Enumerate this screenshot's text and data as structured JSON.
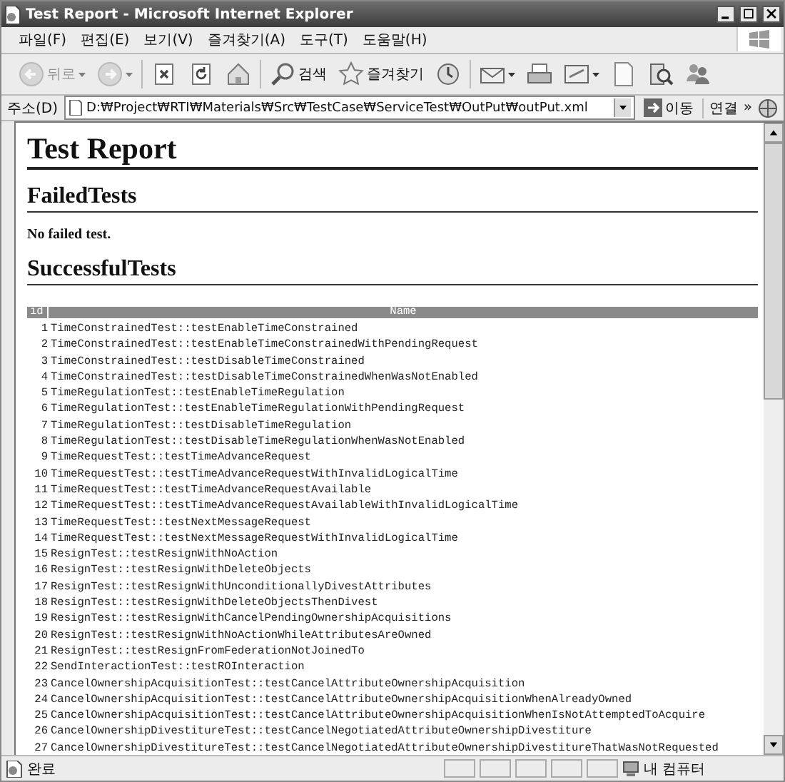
{
  "window": {
    "title": "Test Report - Microsoft Internet Explorer"
  },
  "menu": [
    {
      "label": "파일(F)"
    },
    {
      "label": "편집(E)"
    },
    {
      "label": "보기(V)"
    },
    {
      "label": "즐겨찾기(A)"
    },
    {
      "label": "도구(T)"
    },
    {
      "label": "도움말(H)"
    }
  ],
  "toolbar": [
    {
      "kind": "back",
      "label": "뒤로",
      "disabled": true,
      "dropdown": true
    },
    {
      "kind": "forward",
      "disabled": true,
      "dropdown": true
    },
    {
      "kind": "stop",
      "disabled": false
    },
    {
      "kind": "refresh",
      "disabled": false
    },
    {
      "kind": "home",
      "disabled": false
    },
    {
      "kind": "search",
      "label": "검색",
      "disabled": false
    },
    {
      "kind": "favorites",
      "label": "즐겨찾기",
      "disabled": false
    },
    {
      "kind": "history",
      "disabled": false
    },
    {
      "kind": "mail",
      "disabled": false,
      "dropdown": true
    },
    {
      "kind": "print",
      "disabled": false
    },
    {
      "kind": "edit",
      "disabled": false,
      "dropdown": true
    },
    {
      "kind": "page",
      "disabled": false
    },
    {
      "kind": "research",
      "disabled": false
    },
    {
      "kind": "messenger",
      "disabled": false
    }
  ],
  "address": {
    "label": "주소(D)",
    "value": "D:₩Project₩RTI₩Materials₩Src₩TestCase₩ServiceTest₩OutPut₩outPut.xml",
    "go": "이동",
    "links": "연결",
    "more": "»"
  },
  "document": {
    "title": "Test Report",
    "failed": {
      "heading": "FailedTests",
      "message": "No failed test."
    },
    "successful": {
      "heading": "SuccessfulTests",
      "columns": [
        "id",
        "Name"
      ],
      "rows": [
        {
          "id": "1",
          "name": "TimeConstrainedTest::testEnableTimeConstrained"
        },
        {
          "id": "2",
          "name": "TimeConstrainedTest::testEnableTimeConstrainedWithPendingRequest"
        },
        {
          "id": "3",
          "name": "TimeConstrainedTest::testDisableTimeConstrained"
        },
        {
          "id": "4",
          "name": "TimeConstrainedTest::testDisableTimeConstrainedWhenWasNotEnabled"
        },
        {
          "id": "5",
          "name": "TimeRegulationTest::testEnableTimeRegulation"
        },
        {
          "id": "6",
          "name": "TimeRegulationTest::testEnableTimeRegulationWithPendingRequest"
        },
        {
          "id": "7",
          "name": "TimeRegulationTest::testDisableTimeRegulation"
        },
        {
          "id": "8",
          "name": "TimeRegulationTest::testDisableTimeRegulationWhenWasNotEnabled"
        },
        {
          "id": "9",
          "name": "TimeRequestTest::testTimeAdvanceRequest"
        },
        {
          "id": "10",
          "name": "TimeRequestTest::testTimeAdvanceRequestWithInvalidLogicalTime"
        },
        {
          "id": "11",
          "name": "TimeRequestTest::testTimeAdvanceRequestAvailable"
        },
        {
          "id": "12",
          "name": "TimeRequestTest::testTimeAdvanceRequestAvailableWithInvalidLogicalTime"
        },
        {
          "id": "13",
          "name": "TimeRequestTest::testNextMessageRequest"
        },
        {
          "id": "14",
          "name": "TimeRequestTest::testNextMessageRequestWithInvalidLogicalTime"
        },
        {
          "id": "15",
          "name": "ResignTest::testResignWithNoAction"
        },
        {
          "id": "16",
          "name": "ResignTest::testResignWithDeleteObjects"
        },
        {
          "id": "17",
          "name": "ResignTest::testResignWithUnconditionallyDivestAttributes"
        },
        {
          "id": "18",
          "name": "ResignTest::testResignWithDeleteObjectsThenDivest"
        },
        {
          "id": "19",
          "name": "ResignTest::testResignWithCancelPendingOwnershipAcquisitions"
        },
        {
          "id": "20",
          "name": "ResignTest::testResignWithNoActionWhileAttributesAreOwned"
        },
        {
          "id": "21",
          "name": "ResignTest::testResignFromFederationNotJoinedTo"
        },
        {
          "id": "22",
          "name": "SendInteractionTest::testROInteraction"
        },
        {
          "id": "23",
          "name": "CancelOwnershipAcquisitionTest::testCancelAttributeOwnershipAcquisition"
        },
        {
          "id": "24",
          "name": "CancelOwnershipAcquisitionTest::testCancelAttributeOwnershipAcquisitionWhenAlreadyOwned"
        },
        {
          "id": "25",
          "name": "CancelOwnershipAcquisitionTest::testCancelAttributeOwnershipAcquisitionWhenIsNotAttemptedToAcquire"
        },
        {
          "id": "26",
          "name": "CancelOwnershipDivestitureTest::testCancelNegotiatedAttributeOwnershipDivestiture"
        },
        {
          "id": "27",
          "name": "CancelOwnershipDivestitureTest::testCancelNegotiatedAttributeOwnershipDivestitureThatWasNotRequested"
        }
      ]
    }
  },
  "status": {
    "text": "완료",
    "zone": "내 컴퓨터"
  }
}
